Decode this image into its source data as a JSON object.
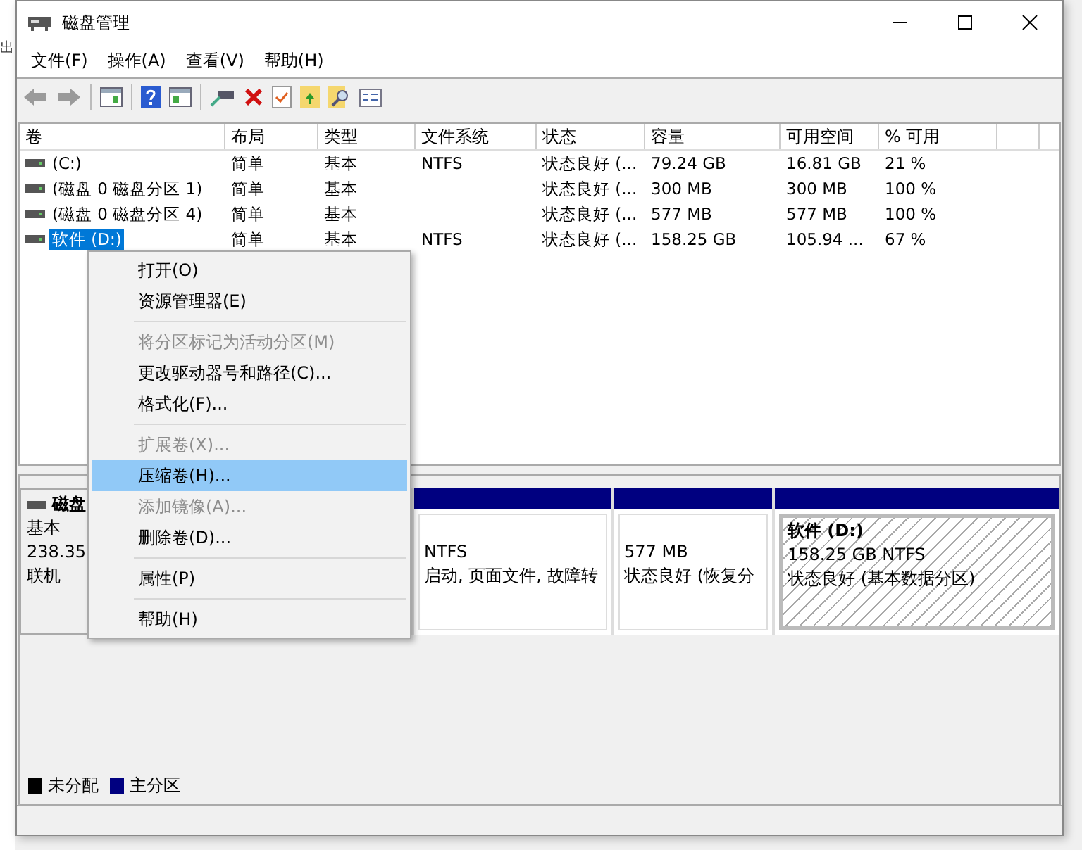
{
  "background_text": "出",
  "window": {
    "title": "磁盘管理"
  },
  "menu_bar": [
    "文件(F)",
    "操作(A)",
    "查看(V)",
    "帮助(H)"
  ],
  "table": {
    "columns": [
      "卷",
      "布局",
      "类型",
      "文件系统",
      "状态",
      "容量",
      "可用空间",
      "% 可用"
    ],
    "rows": [
      {
        "selected": false,
        "cells": [
          "(C:)",
          "简单",
          "基本",
          "NTFS",
          "状态良好 (...",
          "79.24 GB",
          "16.81 GB",
          "21 %"
        ]
      },
      {
        "selected": false,
        "cells": [
          "(磁盘 0 磁盘分区 1)",
          "简单",
          "基本",
          "",
          "状态良好 (...",
          "300 MB",
          "300 MB",
          "100 %"
        ]
      },
      {
        "selected": false,
        "cells": [
          "(磁盘 0 磁盘分区 4)",
          "简单",
          "基本",
          "",
          "状态良好 (...",
          "577 MB",
          "577 MB",
          "100 %"
        ]
      },
      {
        "selected": true,
        "cells": [
          "软件 (D:)",
          "简单",
          "基本",
          "NTFS",
          "状态良好 (...",
          "158.25 GB",
          "105.94 ...",
          "67 %"
        ]
      }
    ]
  },
  "disk": {
    "name": "磁盘",
    "type": "基本",
    "size": "238.35",
    "status": "联机",
    "partitions": [
      {
        "kind": "hidden"
      },
      {
        "kind": "plain",
        "lines": [
          "NTFS",
          "启动, 页面文件, 故障转"
        ]
      },
      {
        "kind": "plain",
        "lines": [
          "577 MB",
          "状态良好 (恢复分"
        ]
      },
      {
        "kind": "hatched",
        "title": "软件  (D:)",
        "lines": [
          "158.25 GB NTFS",
          "状态良好 (基本数据分区)"
        ]
      }
    ]
  },
  "legend": [
    {
      "label": "未分配",
      "color": "#000000"
    },
    {
      "label": "主分区",
      "color": "#000080"
    }
  ],
  "context_menu": [
    {
      "kind": "item",
      "label": "打开(O)",
      "disabled": false,
      "selected": false
    },
    {
      "kind": "item",
      "label": "资源管理器(E)",
      "disabled": false,
      "selected": false
    },
    {
      "kind": "separator"
    },
    {
      "kind": "item",
      "label": "将分区标记为活动分区(M)",
      "disabled": true,
      "selected": false
    },
    {
      "kind": "item",
      "label": "更改驱动器号和路径(C)...",
      "disabled": false,
      "selected": false
    },
    {
      "kind": "item",
      "label": "格式化(F)...",
      "disabled": false,
      "selected": false
    },
    {
      "kind": "separator"
    },
    {
      "kind": "item",
      "label": "扩展卷(X)...",
      "disabled": true,
      "selected": false
    },
    {
      "kind": "item",
      "label": "压缩卷(H)...",
      "disabled": false,
      "selected": true
    },
    {
      "kind": "item",
      "label": "添加镜像(A)...",
      "disabled": true,
      "selected": false
    },
    {
      "kind": "item",
      "label": "删除卷(D)...",
      "disabled": false,
      "selected": false
    },
    {
      "kind": "separator"
    },
    {
      "kind": "item",
      "label": "属性(P)",
      "disabled": false,
      "selected": false
    },
    {
      "kind": "separator"
    },
    {
      "kind": "item",
      "label": "帮助(H)",
      "disabled": false,
      "selected": false
    }
  ]
}
